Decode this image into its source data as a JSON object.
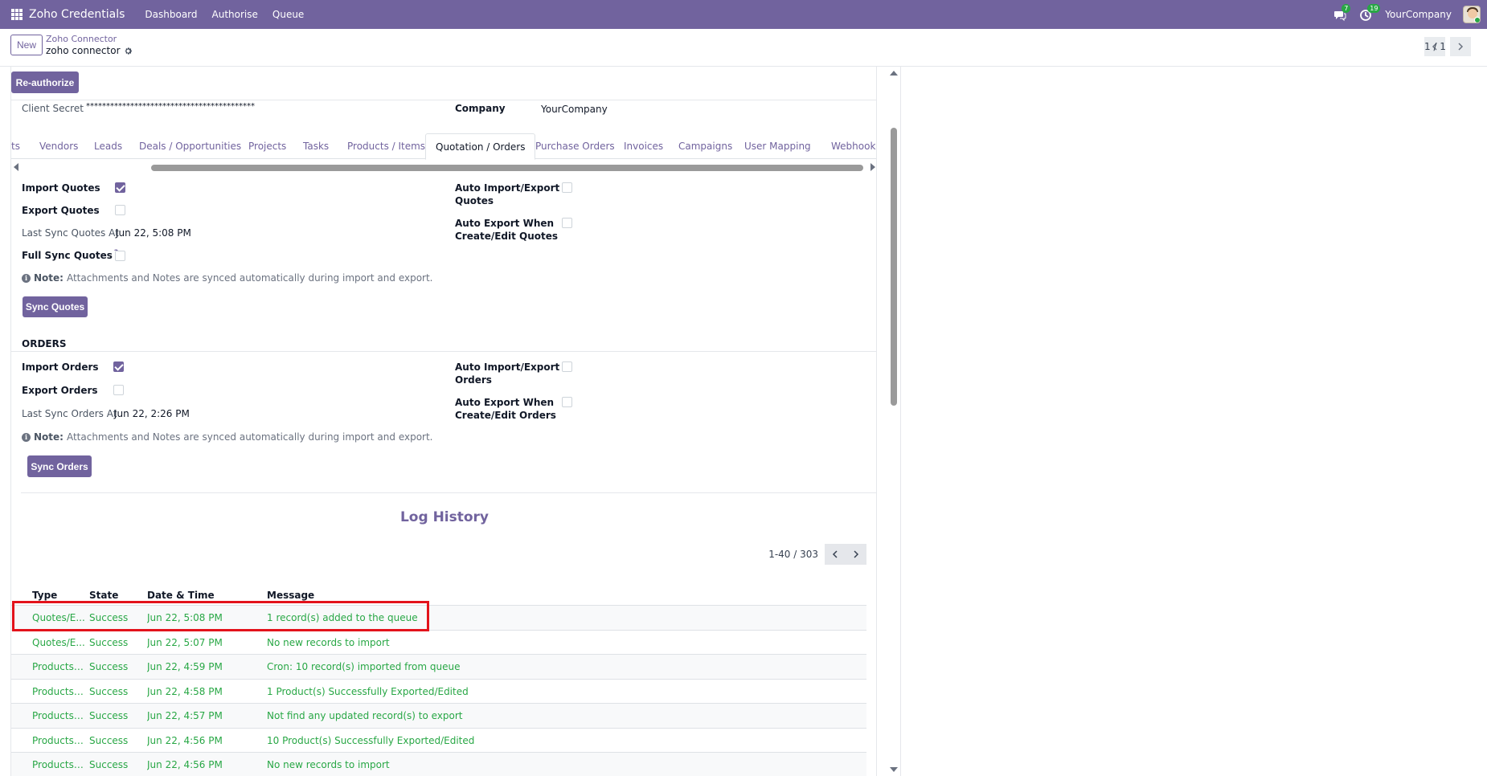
{
  "navbar": {
    "app_title": "Zoho Credentials",
    "menu": [
      "Dashboard",
      "Authorise",
      "Queue"
    ],
    "messages_count": "7",
    "activities_count": "19",
    "company": "YourCompany"
  },
  "control_panel": {
    "new_label": "New",
    "breadcrumb_parent": "Zoho Connector",
    "breadcrumb_current": "zoho connector",
    "pager": "1 / 1"
  },
  "form": {
    "reauthorize_label": "Re-authorize",
    "client_secret_label": "Client Secret",
    "client_secret_value": "******************************************",
    "company_label": "Company",
    "company_value": "YourCompany"
  },
  "tabs": [
    {
      "label": "ts"
    },
    {
      "label": "Vendors"
    },
    {
      "label": "Leads"
    },
    {
      "label": "Deals / Opportunities"
    },
    {
      "label": "Projects"
    },
    {
      "label": "Tasks"
    },
    {
      "label": "Products / Items"
    },
    {
      "label": "Quotation / Orders",
      "active": true
    },
    {
      "label": "Purchase Orders"
    },
    {
      "label": "Invoices"
    },
    {
      "label": "Campaigns"
    },
    {
      "label": "User Mapping"
    },
    {
      "label": "Webhooks"
    }
  ],
  "quotes": {
    "import_label": "Import Quotes",
    "import_checked": true,
    "export_label": "Export Quotes",
    "export_checked": false,
    "last_sync_label": "Last Sync Quotes At",
    "last_sync_value": "Jun 22, 5:08 PM",
    "full_sync_label": "Full Sync Quotes",
    "full_sync_help": "?",
    "full_sync_checked": false,
    "auto_import_label_1": "Auto Import/Export",
    "auto_import_label_2": "Quotes",
    "auto_import_checked": false,
    "auto_export_label_1": "Auto Export When",
    "auto_export_label_2": "Create/Edit Quotes",
    "auto_export_checked": false,
    "note_label": "Note:",
    "note_text": "Attachments and Notes are synced automatically during import and export.",
    "sync_button": "Sync Quotes"
  },
  "orders": {
    "section_title": "ORDERS",
    "import_label": "Import Orders",
    "import_checked": true,
    "export_label": "Export Orders",
    "export_checked": false,
    "last_sync_label": "Last Sync Orders At",
    "last_sync_value": "Jun 22, 2:26 PM",
    "auto_import_label_1": "Auto Import/Export",
    "auto_import_label_2": "Orders",
    "auto_import_checked": false,
    "auto_export_label_1": "Auto Export When",
    "auto_export_label_2": "Create/Edit Orders",
    "auto_export_checked": false,
    "note_label": "Note:",
    "note_text": "Attachments and Notes are synced automatically during import and export.",
    "sync_button": "Sync Orders"
  },
  "log_history": {
    "title": "Log History",
    "pager": "1-40 / 303",
    "columns": [
      "Type",
      "State",
      "Date & Time",
      "Message"
    ],
    "rows": [
      {
        "type": "Quotes/E...",
        "state": "Success",
        "datetime": "Jun 22, 5:08 PM",
        "message": "1 record(s) added to the queue"
      },
      {
        "type": "Quotes/E...",
        "state": "Success",
        "datetime": "Jun 22, 5:07 PM",
        "message": "No new records to import"
      },
      {
        "type": "Products/...",
        "state": "Success",
        "datetime": "Jun 22, 4:59 PM",
        "message": "Cron: 10 record(s) imported from queue"
      },
      {
        "type": "Products/...",
        "state": "Success",
        "datetime": "Jun 22, 4:58 PM",
        "message": "1 Product(s) Successfully Exported/Edited"
      },
      {
        "type": "Products/...",
        "state": "Success",
        "datetime": "Jun 22, 4:57 PM",
        "message": "Not find any updated record(s) to export"
      },
      {
        "type": "Products/...",
        "state": "Success",
        "datetime": "Jun 22, 4:56 PM",
        "message": "10 Product(s) Successfully Exported/Edited"
      },
      {
        "type": "Products/...",
        "state": "Success",
        "datetime": "Jun 22, 4:56 PM",
        "message": "No new records to import"
      }
    ]
  },
  "colors": {
    "brand": "#71639e",
    "success_text": "#28a745",
    "highlight_border": "#e3131b"
  }
}
